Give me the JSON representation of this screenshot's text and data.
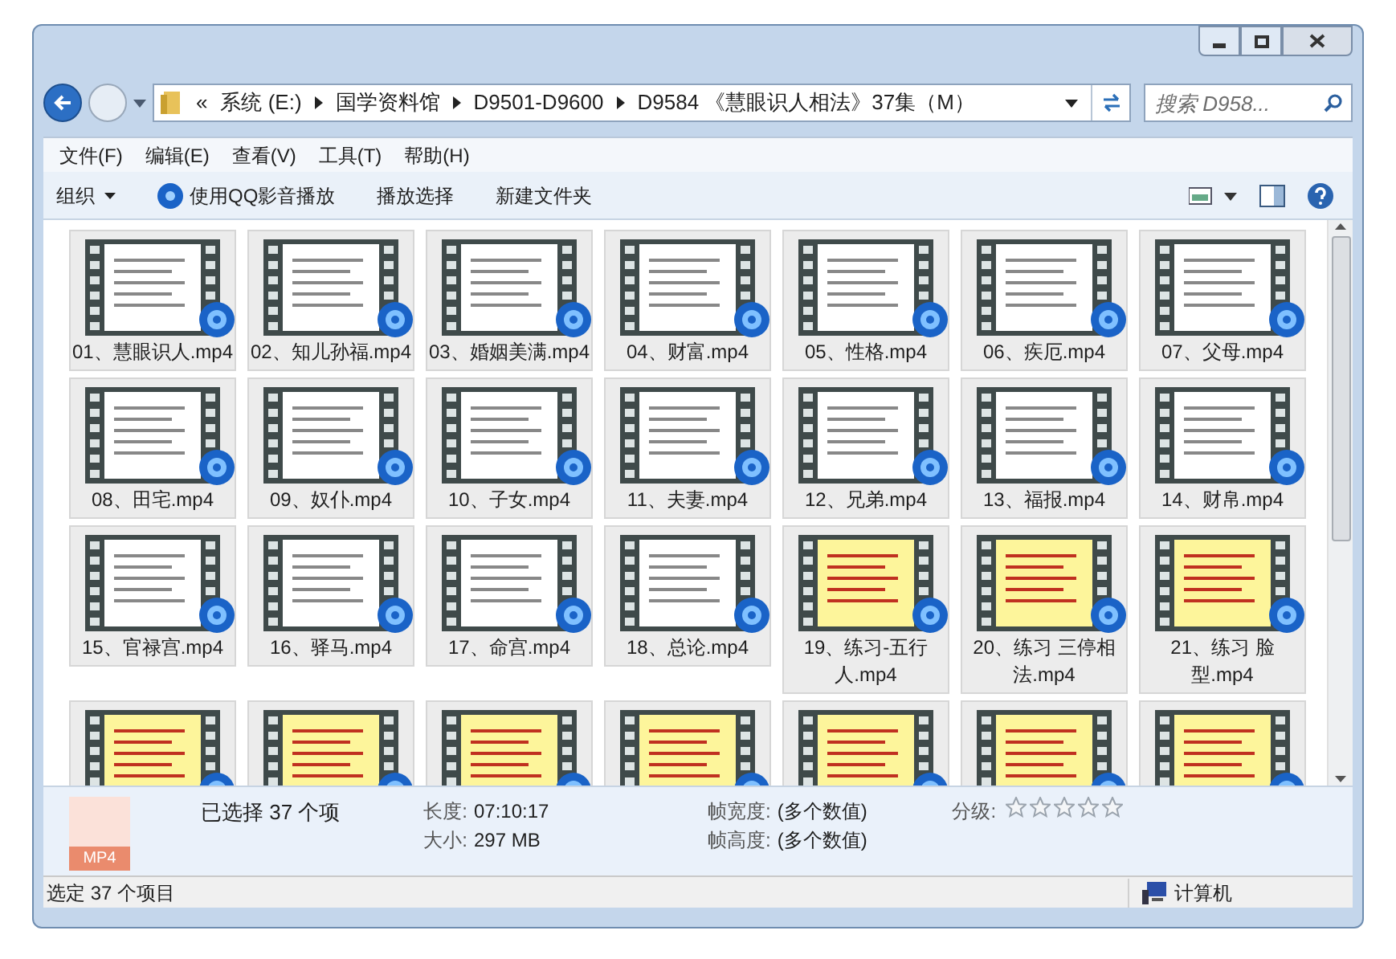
{
  "address": {
    "overflow": "«",
    "crumbs": [
      "系统 (E:)",
      "国学资料馆",
      "D9501-D9600",
      "D9584 《慧眼识人相法》37集（M）"
    ]
  },
  "search": {
    "placeholder": "搜索 D958..."
  },
  "menu": [
    "文件(F)",
    "编辑(E)",
    "查看(V)",
    "工具(T)",
    "帮助(H)"
  ],
  "toolbar": {
    "organize": "组织",
    "items": [
      "使用QQ影音播放",
      "播放选择",
      "新建文件夹"
    ]
  },
  "files": [
    {
      "label": "01、慧眼识人.mp4",
      "selected": true
    },
    {
      "label": "02、知儿孙福.mp4",
      "selected": true
    },
    {
      "label": "03、婚姻美满.mp4",
      "selected": true
    },
    {
      "label": "04、财富.mp4",
      "selected": true
    },
    {
      "label": "05、性格.mp4",
      "selected": true
    },
    {
      "label": "06、疾厄.mp4",
      "selected": true
    },
    {
      "label": "07、父母.mp4",
      "selected": true
    },
    {
      "label": "08、田宅.mp4",
      "selected": true
    },
    {
      "label": "09、奴仆.mp4",
      "selected": true
    },
    {
      "label": "10、子女.mp4",
      "selected": true
    },
    {
      "label": "11、夫妻.mp4",
      "selected": true
    },
    {
      "label": "12、兄弟.mp4",
      "selected": true
    },
    {
      "label": "13、福报.mp4",
      "selected": true
    },
    {
      "label": "14、财帛.mp4",
      "selected": true
    },
    {
      "label": "15、官禄宫.mp4",
      "selected": true
    },
    {
      "label": "16、驿马.mp4",
      "selected": true
    },
    {
      "label": "17、命宫.mp4",
      "selected": true
    },
    {
      "label": "18、总论.mp4",
      "selected": true
    },
    {
      "label": "19、练习-五行人.mp4",
      "selected": true
    },
    {
      "label": "20、练习 三停相法.mp4",
      "selected": true
    },
    {
      "label": "21、练习 脸型.mp4",
      "selected": true
    },
    {
      "selected": true
    },
    {
      "selected": true
    },
    {
      "selected": true
    },
    {
      "selected": true
    },
    {
      "selected": true
    },
    {
      "selected": true
    },
    {
      "selected": true
    }
  ],
  "details": {
    "icon_text": "MP4",
    "selection": "已选择 37 个项",
    "fields": [
      {
        "label": "长度:",
        "value": "07:10:17"
      },
      {
        "label": "大小:",
        "value": "297 MB"
      },
      {
        "label": "帧宽度:",
        "value": "(多个数值)"
      },
      {
        "label": "帧高度:",
        "value": "(多个数值)"
      }
    ],
    "rating_label": "分级:",
    "stars": 0
  },
  "status_bar": {
    "text": "选定 37 个项目",
    "location": "计算机"
  }
}
